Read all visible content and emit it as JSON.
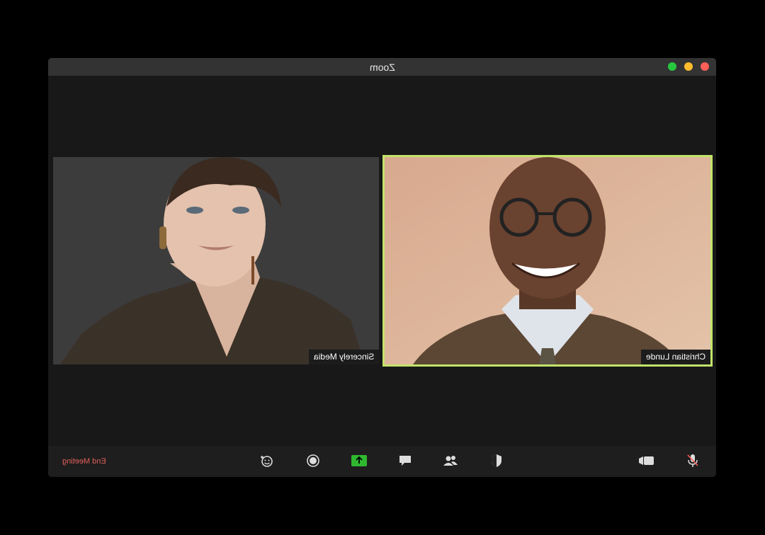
{
  "window": {
    "title": "Zoom"
  },
  "traffic_lights": [
    {
      "name": "green",
      "color": "#27c93f"
    },
    {
      "name": "yellow",
      "color": "#ffbd2e"
    },
    {
      "name": "red",
      "color": "#ff5f56"
    }
  ],
  "participants": [
    {
      "name": "Sincerely Media",
      "active": false
    },
    {
      "name": "Christian Lunde",
      "active": true
    }
  ],
  "toolbar": {
    "end_meeting_label": "End Meeting",
    "icons": [
      "reactions-icon",
      "record-icon",
      "share-screen-icon",
      "chat-icon",
      "participants-icon",
      "security-icon",
      "video-icon",
      "mic-muted-icon"
    ]
  },
  "colors": {
    "active_speaker_border": "#c2e36a",
    "share_green": "#2fb82f",
    "end_red": "#e0605a"
  }
}
